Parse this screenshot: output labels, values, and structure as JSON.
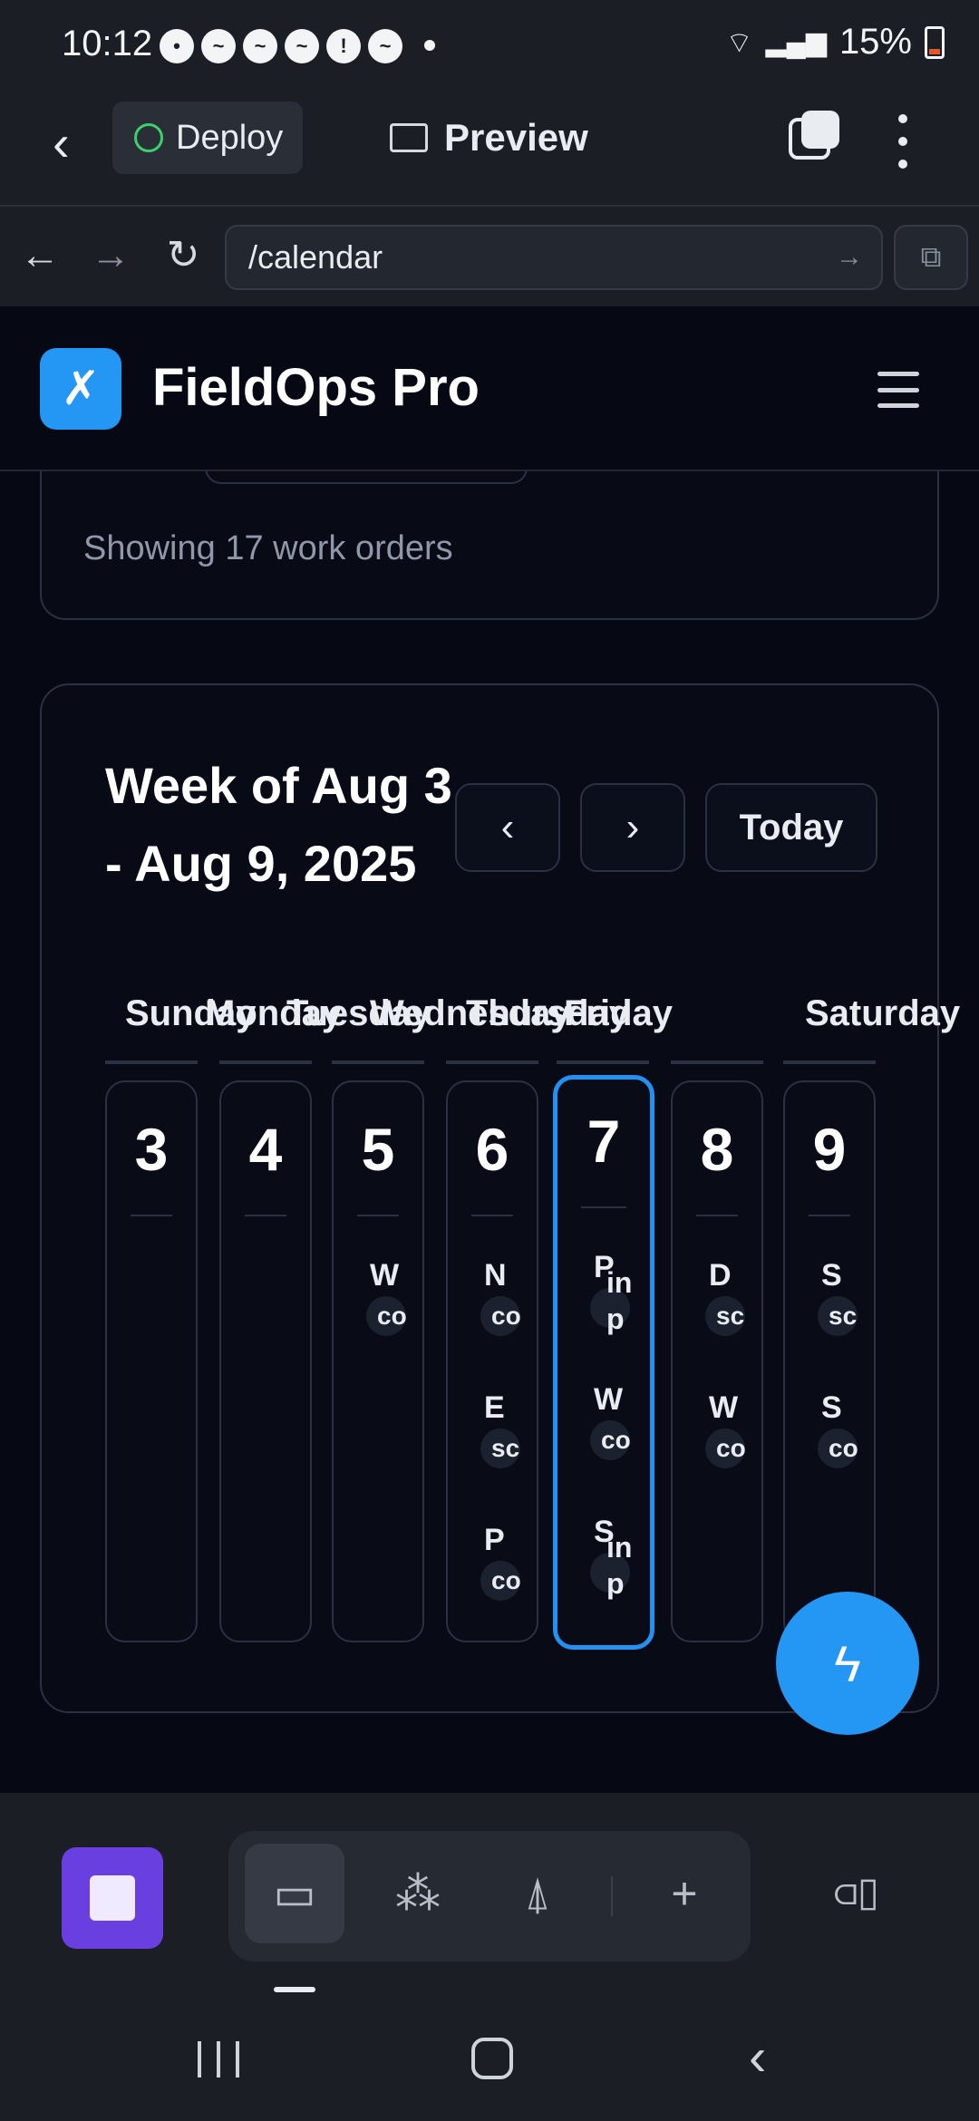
{
  "status_bar": {
    "time": "10:12",
    "notification_icons": [
      "chat-bubble-icon",
      "messenger-icon",
      "messenger-icon",
      "messenger-icon",
      "alert-icon",
      "messenger-icon"
    ],
    "battery": "15%"
  },
  "toolbar": {
    "deploy_label": "Deploy",
    "preview_label": "Preview"
  },
  "urlbar": {
    "url": "/calendar"
  },
  "app": {
    "title": "FieldOps Pro",
    "brand_color": "#2496f3"
  },
  "summary": {
    "text": "Showing 17 work orders"
  },
  "calendar": {
    "week_title": "Week of Aug 3 - Aug 9, 2025",
    "today_label": "Today",
    "days": [
      {
        "name": "Sunday",
        "date": "3",
        "events": []
      },
      {
        "name": "Monday",
        "date": "4",
        "events": []
      },
      {
        "name": "Tuesday",
        "date": "5",
        "events": [
          {
            "title": "W",
            "badge": "co"
          }
        ]
      },
      {
        "name": "Wednesday",
        "date": "6",
        "events": [
          {
            "title": "N",
            "badge": "co"
          },
          {
            "title": "E",
            "badge": "sc"
          },
          {
            "title": "P",
            "badge": "co"
          }
        ]
      },
      {
        "name": "Thursday",
        "date": "7",
        "today": true,
        "events": [
          {
            "title": "P",
            "badge": "in p"
          },
          {
            "title": "W",
            "badge": "co"
          },
          {
            "title": "S",
            "badge": "in p"
          }
        ]
      },
      {
        "name": "Friday",
        "date": "8",
        "events": [
          {
            "title": "D",
            "badge": "sc"
          },
          {
            "title": "W",
            "badge": "co"
          }
        ]
      },
      {
        "name": "Saturday",
        "date": "9",
        "events": [
          {
            "title": "S",
            "badge": "sc"
          },
          {
            "title": "S",
            "badge": "co"
          }
        ]
      }
    ]
  }
}
